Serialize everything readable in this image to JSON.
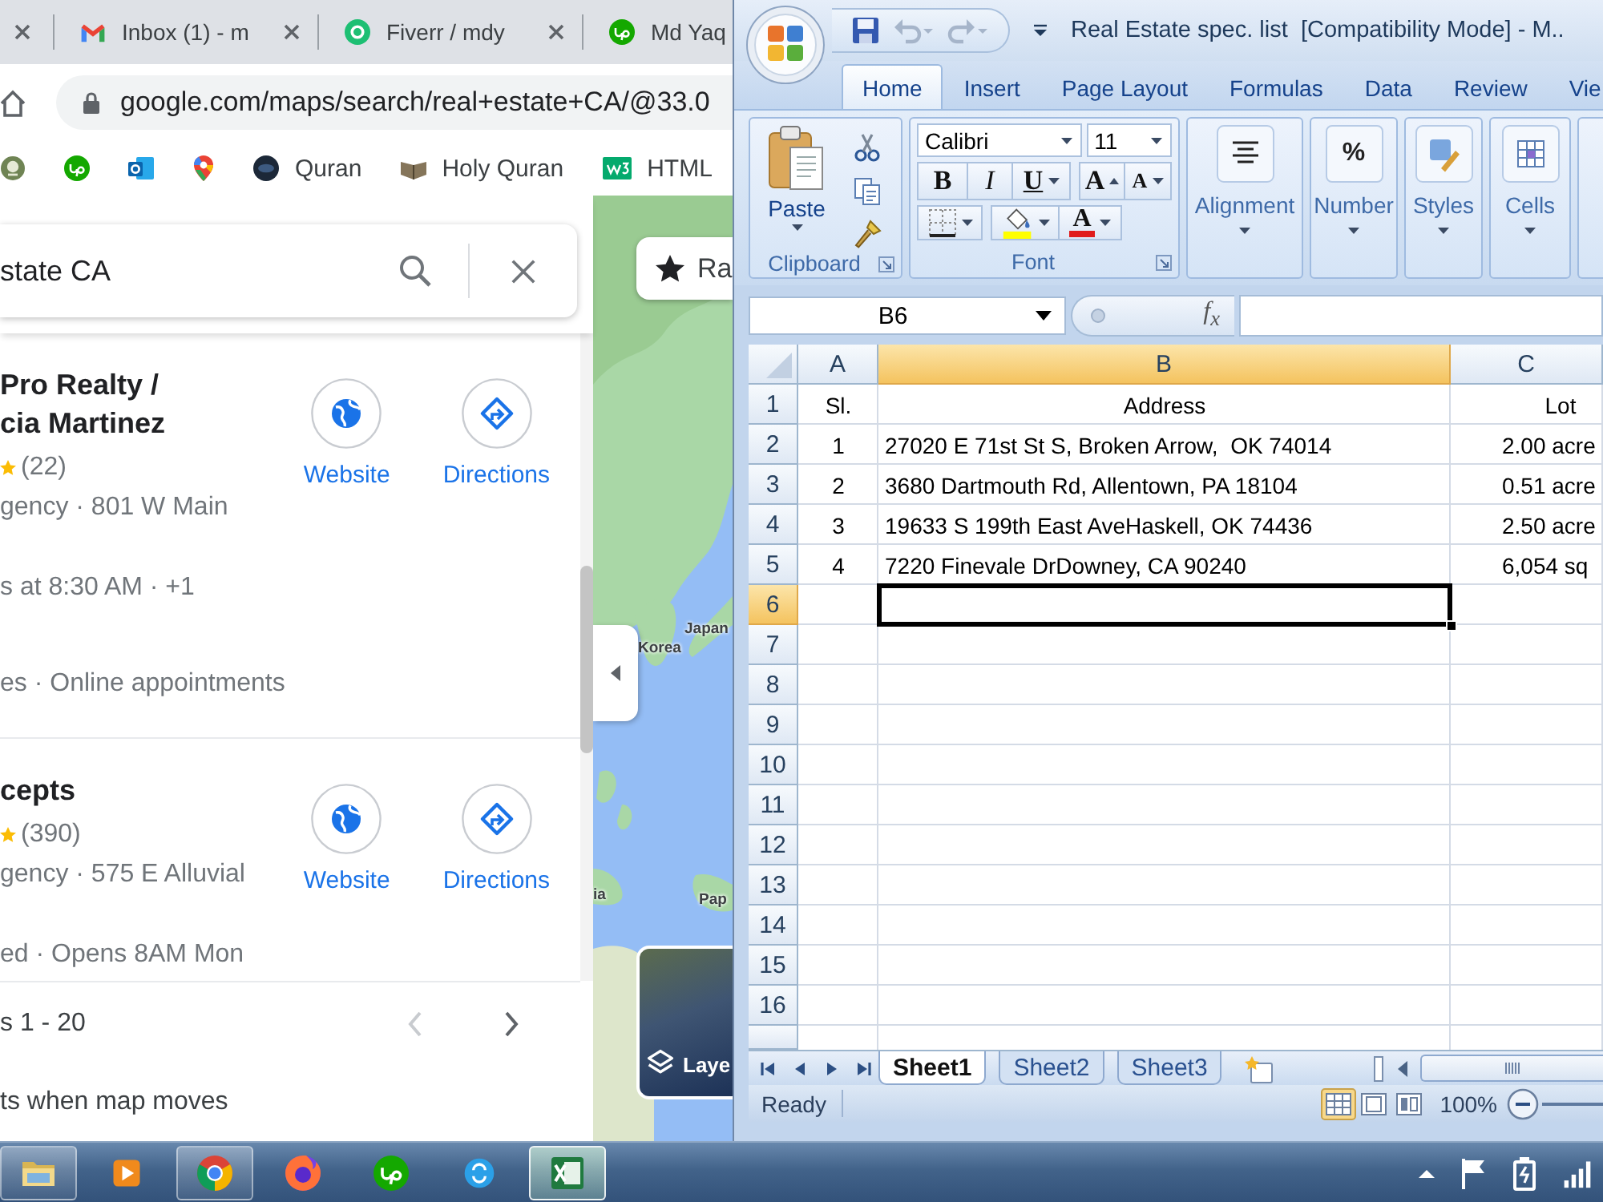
{
  "browser": {
    "tabs": [
      {
        "kind": "stub",
        "closable": true
      },
      {
        "kind": "mail",
        "label": "Inbox (1) - m",
        "closable": true
      },
      {
        "kind": "fiverr",
        "label": "Fiverr / mdy",
        "closable": true
      },
      {
        "kind": "upwork",
        "label": "Md Yaq",
        "closable": false
      }
    ],
    "address": {
      "url": "google.com/maps/search/real+estate+CA/@33.0"
    },
    "bookmarks": [
      {
        "kind": "emblem"
      },
      {
        "kind": "upwork"
      },
      {
        "kind": "outlook"
      },
      {
        "kind": "pin"
      },
      {
        "kind": "disc",
        "label": "Quran"
      },
      {
        "kind": "book",
        "label": "Holy Quran"
      },
      {
        "kind": "w3",
        "label": "HTML"
      }
    ]
  },
  "maps": {
    "search": {
      "value": "state CA"
    },
    "results": [
      {
        "name": "Pro Realty /\ncia Martinez",
        "reviews": "(22)",
        "type_address": "gency · 801 W Main",
        "hours": "s at 8:30 AM · +1",
        "services": "es · Online appointments",
        "actions": [
          {
            "kind": "website",
            "label": "Website"
          },
          {
            "kind": "directions",
            "label": "Directions"
          }
        ]
      },
      {
        "name": "cepts",
        "reviews": "(390)",
        "type_address": "gency · 575 E Alluvial",
        "hours": "ed · Opens 8AM Mon",
        "actions": [
          {
            "kind": "website",
            "label": "Website"
          },
          {
            "kind": "directions",
            "label": "Directions"
          }
        ]
      }
    ],
    "pager": {
      "range": "s 1 - 20",
      "prev_disabled": true,
      "next_disabled": false
    },
    "update_option": "ts when map moves",
    "map": {
      "chip": "Ra",
      "labels": [
        "Japan",
        "Korea",
        "ia",
        "Pap"
      ],
      "layers": "Laye"
    }
  },
  "excel": {
    "title": "Real Estate spec. list  [Compatibility Mode] - M..",
    "quick_access": [
      {
        "kind": "save",
        "disabled": false
      },
      {
        "kind": "undo",
        "disabled": true
      },
      {
        "kind": "redo",
        "disabled": true
      }
    ],
    "ribbon_tabs": [
      {
        "label": "Home",
        "selected": true
      },
      {
        "label": "Insert",
        "selected": false
      },
      {
        "label": "Page Layout",
        "selected": false
      },
      {
        "label": "Formulas",
        "selected": false
      },
      {
        "label": "Data",
        "selected": false
      },
      {
        "label": "Review",
        "selected": false
      },
      {
        "label": "Vie",
        "selected": false
      }
    ],
    "clipboard": {
      "label": "Clipboard",
      "paste": "Paste"
    },
    "font": {
      "label": "Font",
      "name": "Calibri",
      "size": "11",
      "bold": "B",
      "italic": "I",
      "underline": "U",
      "grow": "A",
      "shrink": "A",
      "text_color_letter": "A"
    },
    "collapsed_groups": [
      {
        "kind": "alignment",
        "label": "Alignment"
      },
      {
        "kind": "number",
        "label": "Number",
        "symbol": "%"
      },
      {
        "kind": "styles",
        "label": "Styles"
      },
      {
        "kind": "cells",
        "label": "Cells"
      }
    ],
    "name_box": "B6",
    "fx": "f$_{x}$",
    "columns": [
      {
        "label": "A",
        "selected": false
      },
      {
        "label": "B",
        "selected": true
      },
      {
        "label": "C",
        "selected": false
      }
    ],
    "rows": [
      {
        "label": "1",
        "selected": false,
        "kind": "header",
        "cells": [
          "Sl.",
          "Address",
          "Lot"
        ]
      },
      {
        "label": "2",
        "selected": false,
        "kind": "data",
        "cells": [
          "1",
          "27020 E 71st St S, Broken Arrow,  OK 74014",
          "2.00 acre"
        ]
      },
      {
        "label": "3",
        "selected": false,
        "kind": "data",
        "cells": [
          "2",
          "3680 Dartmouth Rd, Allentown, PA 18104",
          "0.51 acre"
        ]
      },
      {
        "label": "4",
        "selected": false,
        "kind": "data",
        "cells": [
          "3",
          "19633 S 199th East AveHaskell, OK 74436",
          "2.50 acre"
        ]
      },
      {
        "label": "5",
        "selected": false,
        "kind": "data",
        "cells": [
          "4",
          "7220 Finevale DrDowney, CA 90240",
          "6,054 sq"
        ]
      },
      {
        "label": "6",
        "selected": true
      },
      {
        "label": "7",
        "selected": false
      },
      {
        "label": "8",
        "selected": false
      },
      {
        "label": "9",
        "selected": false
      },
      {
        "label": "10",
        "selected": false
      },
      {
        "label": "11",
        "selected": false
      },
      {
        "label": "12",
        "selected": false
      },
      {
        "label": "13",
        "selected": false
      },
      {
        "label": "14",
        "selected": false
      },
      {
        "label": "15",
        "selected": false
      },
      {
        "label": "16",
        "selected": false
      }
    ],
    "sheets": [
      {
        "label": "Sheet1",
        "selected": true
      },
      {
        "label": "Sheet2",
        "selected": false
      },
      {
        "label": "Sheet3",
        "selected": false
      }
    ],
    "status": "Ready",
    "views": [
      {
        "kind": "normal",
        "selected": true
      },
      {
        "kind": "page_layout",
        "selected": false
      },
      {
        "kind": "page_break",
        "selected": false
      }
    ],
    "zoom": "100%"
  },
  "taskbar": {
    "apps": [
      {
        "kind": "explorer",
        "running": true,
        "selected": false
      },
      {
        "kind": "media",
        "running": false,
        "selected": false
      },
      {
        "kind": "chrome",
        "running": true,
        "selected": false
      },
      {
        "kind": "firefox",
        "running": false,
        "selected": false
      },
      {
        "kind": "upwork",
        "running": false,
        "selected": false
      },
      {
        "kind": "skype",
        "running": false,
        "selected": false
      },
      {
        "kind": "excel",
        "running": true,
        "selected": true
      }
    ]
  }
}
